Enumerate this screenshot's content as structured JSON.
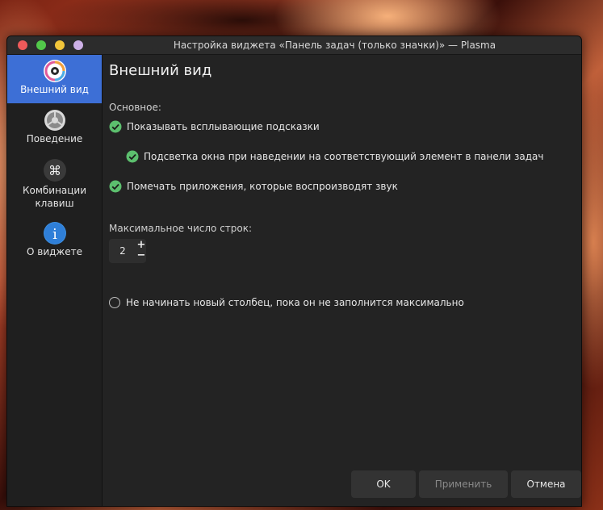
{
  "window": {
    "title": "Настройка виджета «Панель задач (только значки)» — Plasma"
  },
  "sidebar": {
    "items": [
      {
        "label": "Внешний вид",
        "icon": "appearance-icon",
        "active": true
      },
      {
        "label": "Поведение",
        "icon": "behavior-gear-icon",
        "active": false
      },
      {
        "label": "Комбинации клавиш",
        "icon": "shortcuts-command-icon",
        "active": false
      },
      {
        "label": "О виджете",
        "icon": "info-icon",
        "active": false
      }
    ]
  },
  "main": {
    "title": "Внешний вид",
    "section_label": "Основное:",
    "options": [
      {
        "label": "Показывать всплывающие подсказки",
        "checked": true
      },
      {
        "label": "Подсветка окна при наведении на соответствующий элемент в панели задач",
        "checked": true
      },
      {
        "label": "Помечать приложения, которые воспроизводят звук",
        "checked": true
      }
    ],
    "max_rows_label": "Максимальное число строк:",
    "max_rows_value": "2",
    "spin_up": "+",
    "spin_down": "−",
    "fill_column_label": "Не начинать новый столбец, пока он не заполнится максимально",
    "fill_column_checked": false
  },
  "buttons": {
    "ok": "OK",
    "apply": "Применить",
    "cancel": "Отмена"
  },
  "colors": {
    "accent": "#3d6fd6",
    "check": "#5cbf6e",
    "window_bg": "#232323"
  }
}
